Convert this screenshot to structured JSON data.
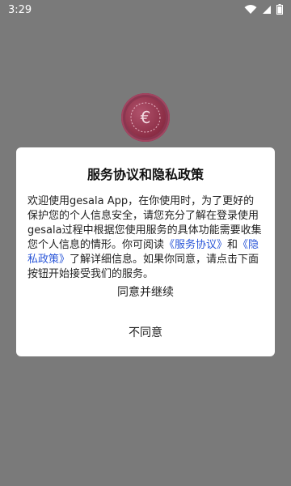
{
  "status_bar": {
    "time": "3:29",
    "icons": [
      "wifi-icon",
      "cellular-icon",
      "battery-icon"
    ]
  },
  "logo": {
    "icon": "euro-seal-logo",
    "symbol": "€",
    "colors": {
      "primary": "#8c2e46",
      "highlight": "#b0526c"
    }
  },
  "dialog": {
    "title": "服务协议和隐私政策",
    "body": {
      "part1": "欢迎使用gesala App，在你使用时，为了更好的保护您的个人信息安全，请您充分了解在登录使用gesala过程中根据您使用服务的具体功能需要收集您个人信息的情形。你可阅读",
      "service_link": "《服务协议》",
      "part2": "和",
      "privacy_link": "《隐私政策》",
      "part3": "了解详细信息。如果你同意，请点击下面按钮开始接受我们的服务。"
    },
    "agree_button": "同意并继续",
    "disagree_button": "不同意"
  },
  "colors": {
    "overlay_background": "#7a7a7a",
    "link": "#2a56d8",
    "dialog_background": "#ffffff"
  }
}
